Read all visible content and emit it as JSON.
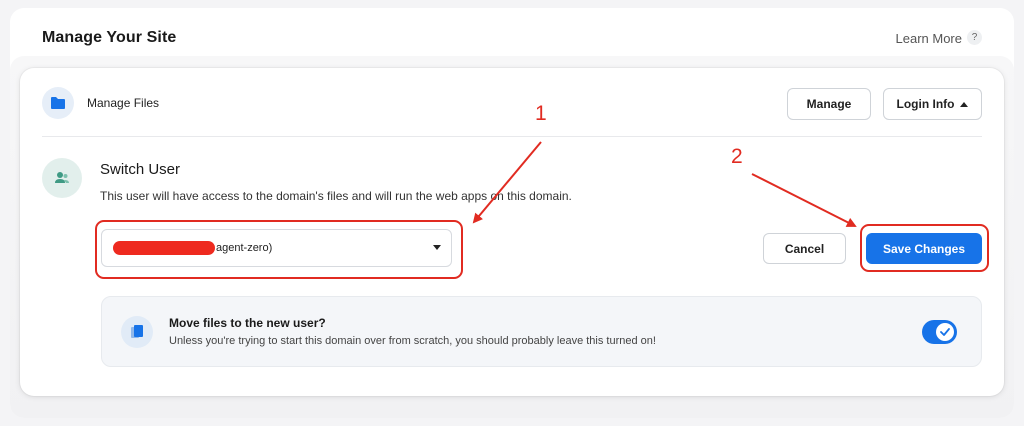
{
  "header": {
    "title": "Manage Your Site",
    "learn_more": "Learn More",
    "help_symbol": "?"
  },
  "manage_files": {
    "label": "Manage Files",
    "manage_button": "Manage",
    "login_info_button": "Login Info"
  },
  "switch_user": {
    "title": "Switch User",
    "description": "This user will have access to the domain's files and will run the web apps on this domain.",
    "selected_user_suffix": "agent-zero)",
    "cancel_button": "Cancel",
    "save_button": "Save Changes"
  },
  "move_files": {
    "title": "Move files to the new user?",
    "description": "Unless you're trying to start this domain over from scratch, you should probably leave this turned on!",
    "toggle_on": true
  },
  "annotations": {
    "label_1": "1",
    "label_2": "2",
    "color": "#e12b21"
  },
  "colors": {
    "accent_blue": "#1773e8",
    "redaction_red": "#ee2a1f"
  },
  "icons": {
    "manage_files": "folder-icon",
    "switch_user": "user-group-icon",
    "move_files": "documents-icon",
    "toggle": "check-icon"
  }
}
